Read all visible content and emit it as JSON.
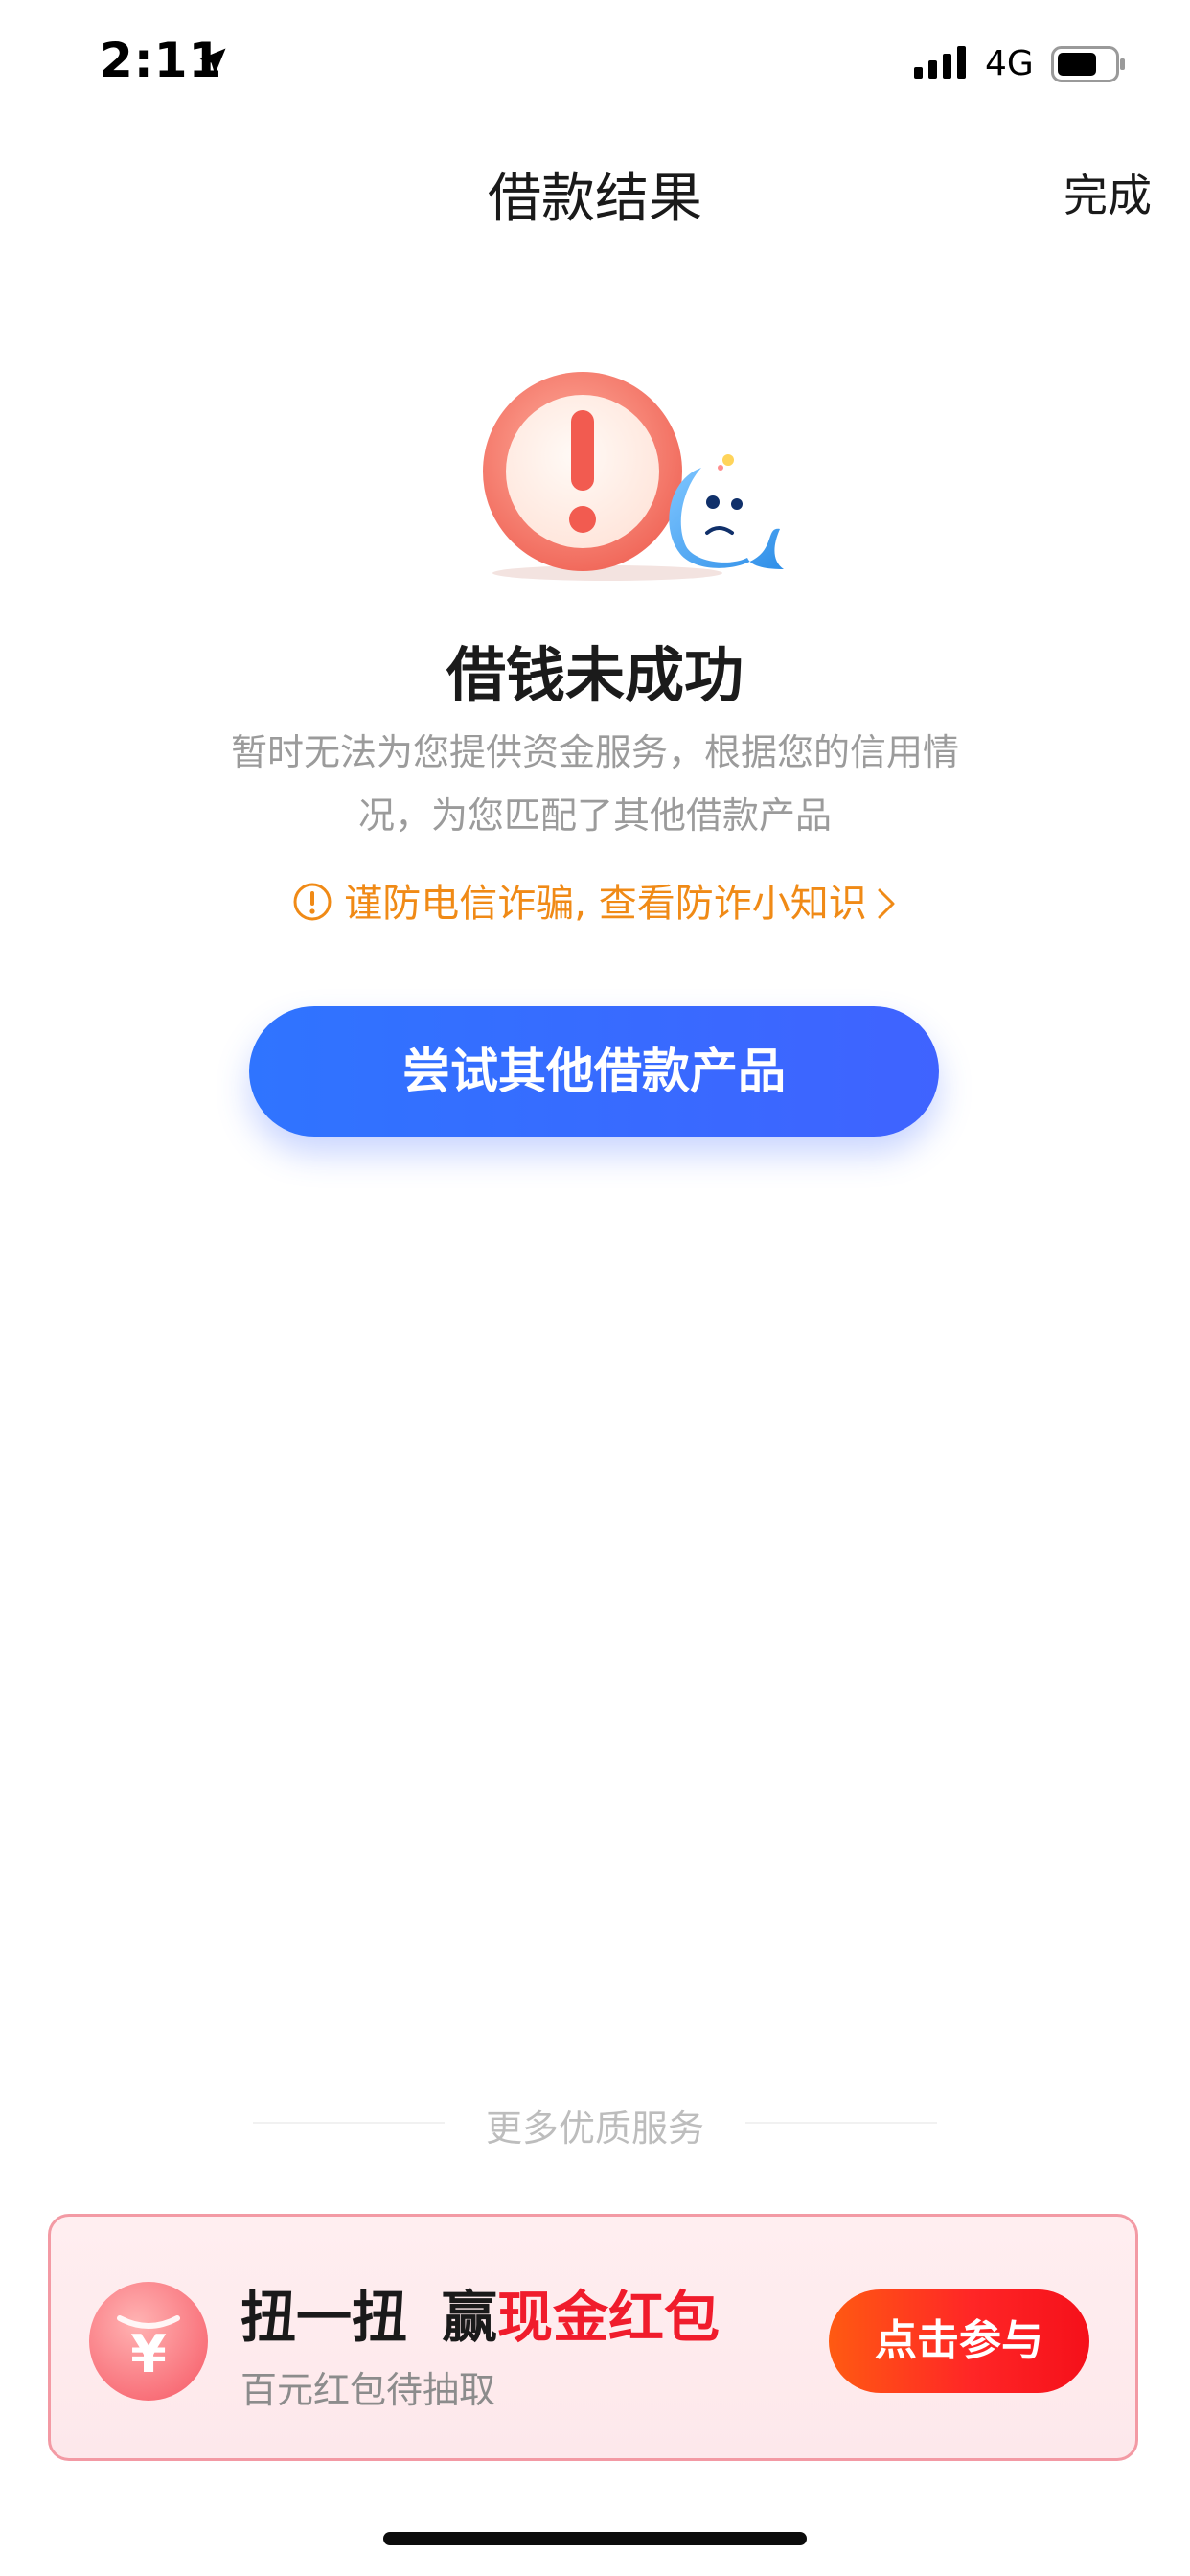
{
  "status_bar": {
    "time": "2:11",
    "network": "4G",
    "icons": [
      "location-arrow-icon",
      "signal-bars-icon",
      "battery-icon"
    ]
  },
  "nav": {
    "title": "借款结果",
    "done_label": "完成"
  },
  "result": {
    "illustration": "warning-exclamation-with-mascot",
    "title": "借钱未成功",
    "description_line1": "暂时无法为您提供资金服务，根据您的信用情",
    "description_line2": "况，为您匹配了其他借款产品",
    "fraud_tip": "谨防电信诈骗, 查看防诈小知识",
    "primary_button": "尝试其他借款产品"
  },
  "more_services": {
    "label": "更多优质服务"
  },
  "promo": {
    "icon": "yuan-coin-icon",
    "title_part1": "扭一扭",
    "title_part2": "赢",
    "title_highlight": "现金红包",
    "subtitle": "百元红包待抽取",
    "button": "点击参与"
  },
  "colors": {
    "primary_blue": "#2f74ff",
    "warning_orange": "#f08a16",
    "promo_red": "#f01c2c",
    "promo_border": "#f39aa4",
    "promo_bg": "#ffeef0",
    "text_gray": "#9b9b9b"
  }
}
